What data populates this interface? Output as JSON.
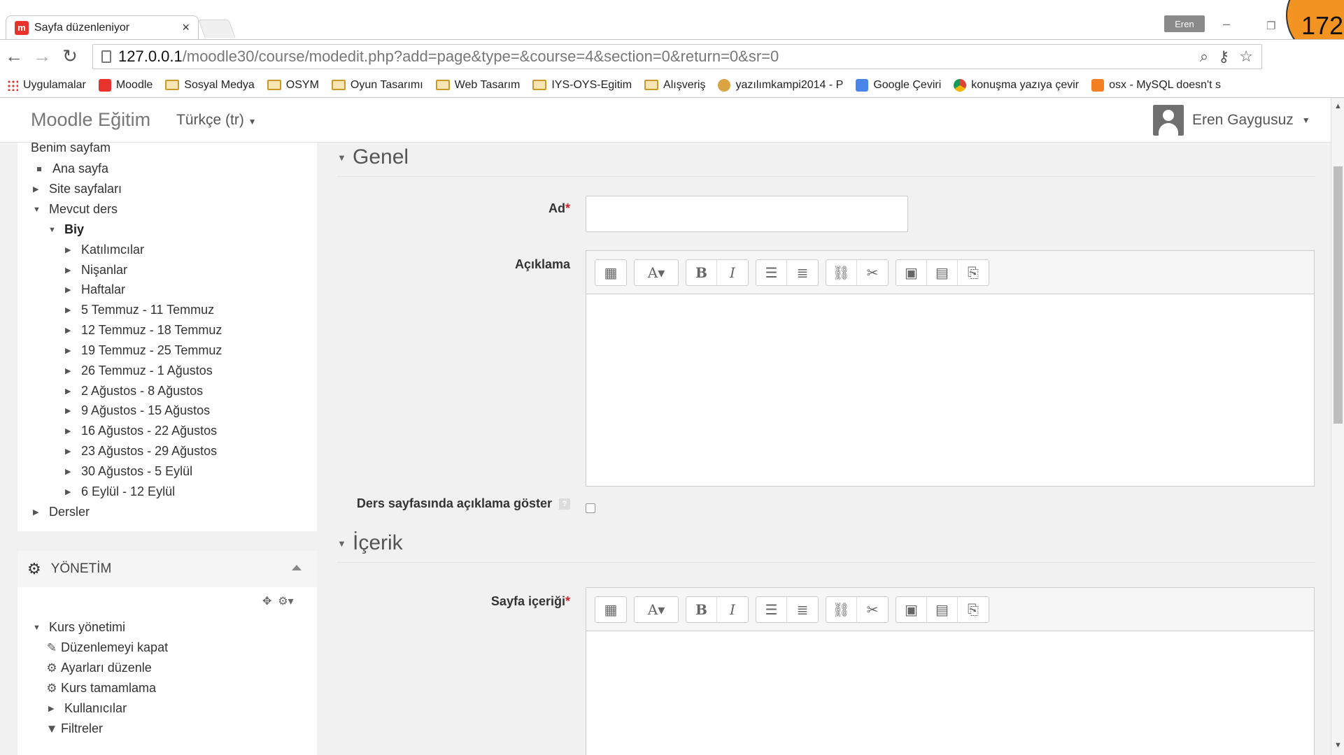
{
  "browser": {
    "tab_title": "Sayfa düzenleniyor",
    "tab_close": "×",
    "profile_name": "Eren",
    "badge_number": "172",
    "url_host": "127.0.0.1",
    "url_path": "/moodle30/course/modedit.php?add=page&type=&course=4&section=0&return=0&sr=0",
    "bookmarks": [
      "Uygulamalar",
      "Moodle",
      "Sosyal Medya",
      "OSYM",
      "Oyun Tasarımı",
      "Web Tasarım",
      "IYS-OYS-Egitim",
      "Alışveriş",
      "yazılımkampi2014 - P",
      "Google Çeviri",
      "konuşma yazıya çevir",
      "osx - MySQL doesn't s"
    ]
  },
  "navbar": {
    "brand": "Moodle Eğitim",
    "language": "Türkçe ‎(tr)‎",
    "user_name": "Eren Gaygusuz"
  },
  "navigation": {
    "my_page": "Benim sayfam",
    "home": "Ana sayfa",
    "site_pages": "Site sayfaları",
    "current_course": "Mevcut ders",
    "course_name": "Biy",
    "items": [
      "Katılımcılar",
      "Nişanlar",
      "Haftalar",
      "5 Temmuz - 11 Temmuz",
      "12 Temmuz - 18 Temmuz",
      "19 Temmuz - 25 Temmuz",
      "26 Temmuz - 1 Ağustos",
      "2 Ağustos - 8 Ağustos",
      "9 Ağustos - 15 Ağustos",
      "16 Ağustos - 22 Ağustos",
      "23 Ağustos - 29 Ağustos",
      "30 Ağustos - 5 Eylül",
      "6 Eylül - 12 Eylül"
    ],
    "courses": "Dersler"
  },
  "administration": {
    "title": "YÖNETİM",
    "course_admin": "Kurs yönetimi",
    "items": [
      "Düzenlemeyi kapat",
      "Ayarları düzenle",
      "Kurs tamamlama",
      "Kullanıcılar",
      "Filtreler"
    ]
  },
  "form": {
    "section_general": "Genel",
    "name_label": "Ad",
    "description_label": "Açıklama",
    "show_description_label": "Ders sayfasında açıklama göster",
    "help": "?",
    "section_content": "İçerik",
    "page_content_label": "Sayfa içeriği",
    "required_mark": "*"
  }
}
